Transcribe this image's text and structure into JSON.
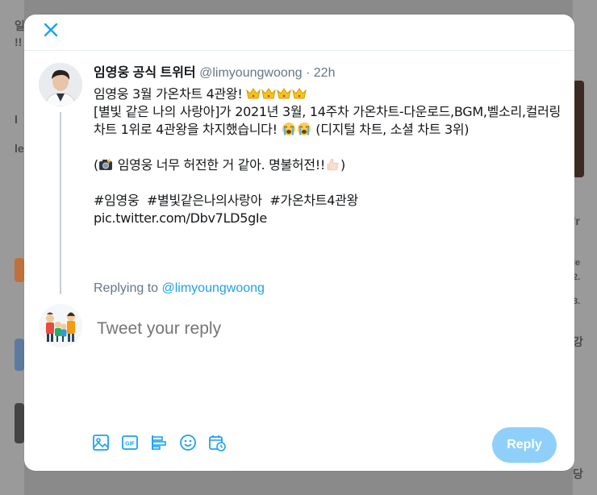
{
  "background": {
    "fragments_left": [
      "일",
      "!!",
      "l",
      "le"
    ],
    "fragments_right": [
      "'r",
      "ie",
      "2.",
      "3.",
      "강",
      "당"
    ]
  },
  "modal": {
    "close_icon": "close-x-icon"
  },
  "tweet": {
    "author_name": "임영웅 공식 트위터",
    "author_handle": "@limyoungwoong",
    "separator": "·",
    "time": "22h",
    "line1": "임영웅 3월 가온차트 4관왕!",
    "line1_emoji": "crown-emoji",
    "line2": "[별빛 같은 나의 사랑아]가 2021년 3월, 14주차 가온차트-다운로드,BGM,벨소리,컬러링차트 1위로 4관왕을 차지했습니다!",
    "line2_emoji": "loudly-crying-emoji",
    "line2_tail": "(디지털 차트,  소셜 차트 3위)",
    "line3_camera_emoji": "camera-flash-emoji",
    "line3": "임영웅 너무 허전한 거 같아. 명불허전!!",
    "line3_emoji": "thumbs-up-emoji",
    "line3_close": ")",
    "line3_open": "(",
    "hashtags": [
      "#임영웅",
      "#별빛같은나의사랑아",
      "#가온차트4관왕"
    ],
    "pic_link": "pic.twitter.com/Dbv7LD5gIe"
  },
  "replying": {
    "prefix": "Replying to",
    "handle": "@limyoungwoong"
  },
  "composer": {
    "placeholder": "Tweet your reply",
    "tools": [
      "image-icon",
      "gif-icon",
      "poll-icon",
      "emoji-icon",
      "schedule-icon"
    ],
    "gif_label": "GIF",
    "reply_label": "Reply"
  },
  "colors": {
    "accent": "#1da1f2",
    "reply_button_disabled": "#8ed0f9",
    "secondary_text": "#657786"
  }
}
